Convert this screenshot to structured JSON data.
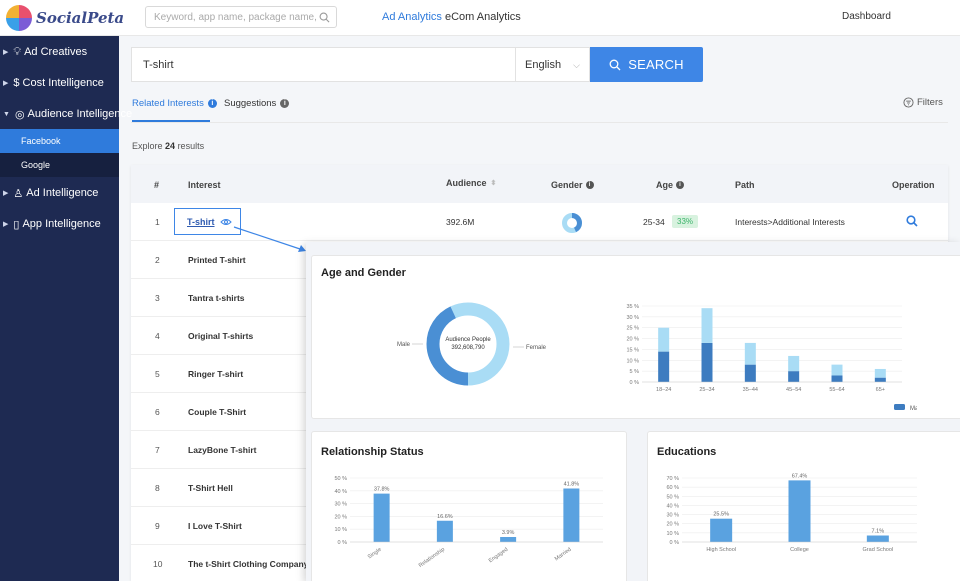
{
  "header": {
    "logo_text": "SocialPeta",
    "search_placeholder": "Keyword, app name, package name, text c",
    "nav": {
      "ad_analytics": "Ad Analytics",
      "ecom_analytics": "eCom Analytics",
      "dashboard": "Dashboard"
    },
    "accent_color": "#2f7bdc"
  },
  "sidebar": {
    "items": [
      {
        "label": "Ad Creatives",
        "icon": "bulb-icon"
      },
      {
        "label": "Cost Intelligence",
        "icon": "dollar-icon"
      },
      {
        "label": "Audience Intelligence",
        "icon": "target-icon",
        "expanded": true
      },
      {
        "label": "Ad Intelligence",
        "icon": "trophy-icon"
      },
      {
        "label": "App Intelligence",
        "icon": "phone-icon"
      }
    ],
    "sub_items": [
      {
        "label": "Facebook",
        "active": true
      },
      {
        "label": "Google",
        "active": false
      }
    ]
  },
  "search": {
    "value": "T-shirt",
    "language": "English",
    "button_label": "SEARCH"
  },
  "tabs": [
    {
      "label": "Related Interests",
      "active": true
    },
    {
      "label": "Suggestions",
      "active": false
    }
  ],
  "filters_label": "Filters",
  "explore": {
    "prefix": "Explore",
    "count": "24",
    "suffix": "results"
  },
  "table": {
    "headers": {
      "num": "#",
      "interest": "Interest",
      "audience": "Audience",
      "gender": "Gender",
      "age": "Age",
      "path": "Path",
      "operation": "Operation"
    },
    "rows": [
      {
        "num": "1",
        "interest": "T-shirt",
        "audience": "392.6M",
        "age": "25-34",
        "age_pct": "33%",
        "path": "Interests>Additional Interests"
      },
      {
        "num": "2",
        "interest": "Printed T-shirt"
      },
      {
        "num": "3",
        "interest": "Tantra t-shirts"
      },
      {
        "num": "4",
        "interest": "Original T-shirts"
      },
      {
        "num": "5",
        "interest": "Ringer T-shirt"
      },
      {
        "num": "6",
        "interest": "Couple T-Shirt"
      },
      {
        "num": "7",
        "interest": "LazyBone T-shirt"
      },
      {
        "num": "8",
        "interest": "T-Shirt Hell"
      },
      {
        "num": "9",
        "interest": "I Love T-Shirt"
      },
      {
        "num": "10",
        "interest": "The t-Shirt Clothing Company"
      }
    ]
  },
  "popup": {
    "age_gender": {
      "title": "Age and Gender",
      "donut": {
        "center_line1": "Audience People",
        "center_line2": "392,608,790",
        "label_left": "Male",
        "label_right": "Female"
      },
      "legend": [
        "Male",
        "Female"
      ]
    },
    "relationship": {
      "title": "Relationship Status"
    },
    "educations": {
      "title": "Educations"
    }
  },
  "chart_data": [
    {
      "type": "pie",
      "title": "Age and Gender",
      "series": [
        {
          "name": "Male",
          "value": 0.43,
          "color": "#4a8fd4"
        },
        {
          "name": "Female",
          "value": 0.57,
          "color": "#a9dcf5"
        }
      ]
    },
    {
      "type": "bar",
      "stacked": true,
      "categories": [
        "18-24",
        "25-34",
        "35-44",
        "45-54",
        "55-64",
        "65+"
      ],
      "series": [
        {
          "name": "Male",
          "values": [
            14,
            18,
            8,
            5,
            3,
            2
          ],
          "color": "#3d7cc0"
        },
        {
          "name": "Female",
          "values": [
            11,
            16,
            10,
            7,
            5,
            4
          ],
          "color": "#a9dcf5"
        }
      ],
      "ylim": [
        0,
        35
      ],
      "yticks": [
        "0 %",
        "5 %",
        "10 %",
        "15 %",
        "20 %",
        "25 %",
        "30 %",
        "35 %"
      ],
      "legend": "bottom"
    },
    {
      "type": "bar",
      "title": "Relationship Status",
      "categories": [
        "Single",
        "Relationship",
        "Engaged",
        "Married"
      ],
      "values": [
        37.8,
        16.6,
        3.9,
        41.8
      ],
      "labels": [
        "37.8%",
        "16.6%",
        "3.9%",
        "41.8%"
      ],
      "ylim": [
        0,
        50
      ],
      "yticks": [
        "0 %",
        "10 %",
        "20 %",
        "30 %",
        "40 %",
        "50 %"
      ],
      "color": "#5aa2e0"
    },
    {
      "type": "bar",
      "title": "Educations",
      "categories": [
        "High School",
        "College",
        "Grad School"
      ],
      "values": [
        25.5,
        67.4,
        7.1
      ],
      "labels": [
        "25.5%",
        "67.4%",
        "7.1%"
      ],
      "ylim": [
        0,
        70
      ],
      "yticks": [
        "0 %",
        "10 %",
        "20 %",
        "30 %",
        "40 %",
        "50 %",
        "60 %",
        "70 %"
      ],
      "color": "#5aa2e0"
    }
  ]
}
